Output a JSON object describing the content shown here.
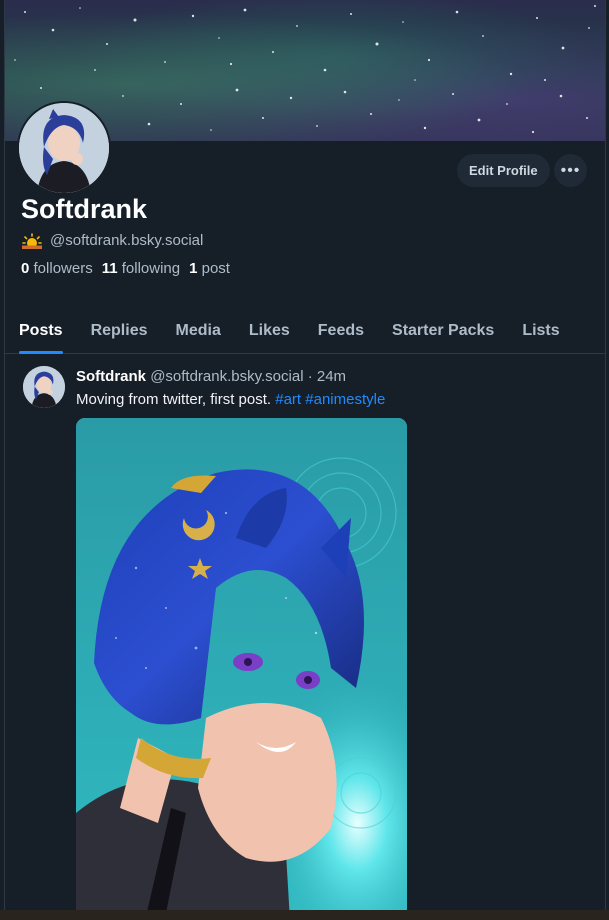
{
  "profile": {
    "display_name": "Softdrank",
    "handle": "@softdrank.bsky.social",
    "handle_icon": "sun-behind-cloud-emoji",
    "followers_count": "0",
    "followers_label": "followers",
    "following_count": "11",
    "following_label": "following",
    "posts_count": "1",
    "posts_label": "post"
  },
  "actions": {
    "edit_label": "Edit Profile",
    "more_label": "•••"
  },
  "tabs": [
    {
      "label": "Posts",
      "active": true
    },
    {
      "label": "Replies"
    },
    {
      "label": "Media"
    },
    {
      "label": "Likes"
    },
    {
      "label": "Feeds"
    },
    {
      "label": "Starter Packs"
    },
    {
      "label": "Lists"
    }
  ],
  "post": {
    "author": "Softdrank",
    "handle": "@softdrank.bsky.social",
    "separator": "·",
    "time": "24m",
    "text": "Moving from twitter, first post.",
    "tag1": "#art",
    "tag2": "#animestyle"
  },
  "colors": {
    "background": "#161e27",
    "accent": "#208bfe",
    "muted_text": "#aebbc9",
    "button_bg": "#1f2a36"
  }
}
